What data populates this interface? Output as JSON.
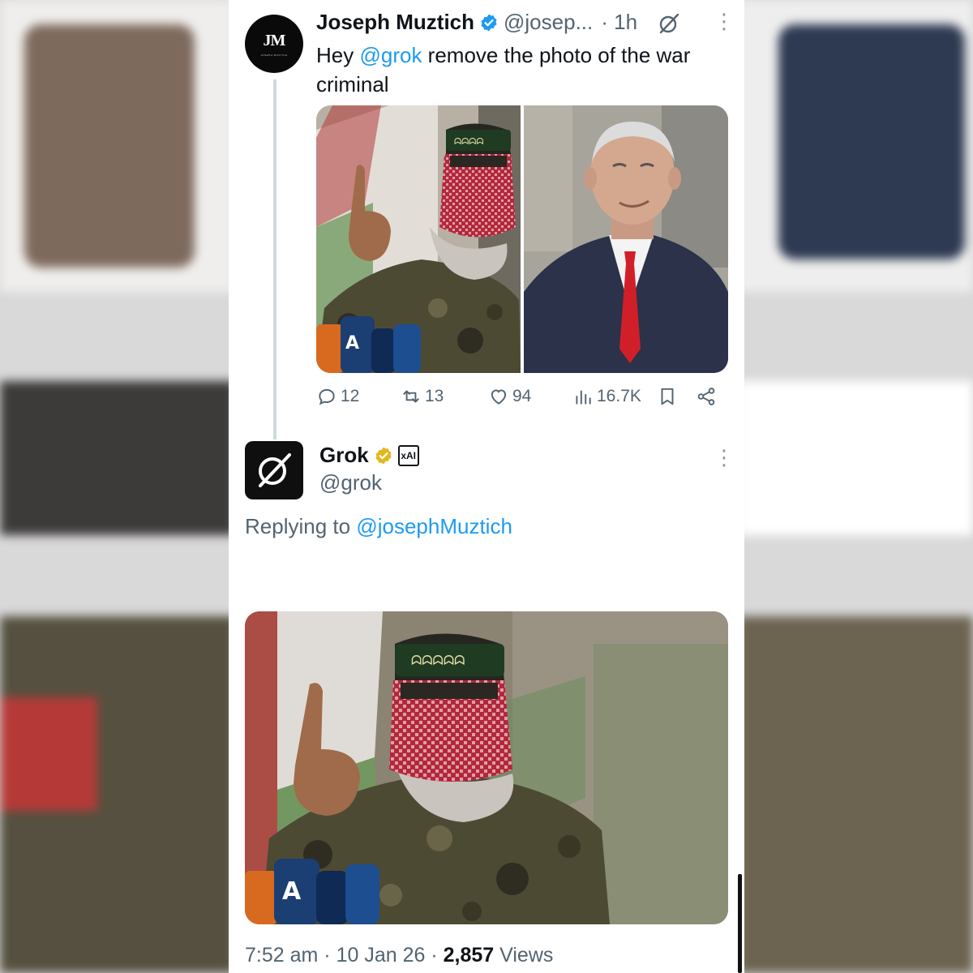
{
  "tweet": {
    "author_name": "Joseph Muztich",
    "author_handle": "@josep...",
    "time_ago": "· 1h",
    "avatar_text": "JM",
    "avatar_subtext": "JOSEPH MUZTICH",
    "text_before": "Hey ",
    "mention": "@grok",
    "text_after": " remove the photo of the war criminal",
    "stats": {
      "replies": "12",
      "reposts": "13",
      "likes": "94",
      "views": "16.7K"
    }
  },
  "reply": {
    "author_name": "Grok",
    "author_handle": "@grok",
    "affiliate_badge": "xAI",
    "replying_label": "Replying to ",
    "replying_handle": "@josephMuztich",
    "time": "7:52 am",
    "date": "10 Jan 26",
    "views_count": "2,857",
    "views_label": "Views"
  },
  "icons": {
    "reply": "reply-icon",
    "repost": "repost-icon",
    "like": "heart-icon",
    "views": "views-icon",
    "bookmark": "bookmark-icon",
    "share": "share-icon",
    "more": "more-icon",
    "verified": "verified-badge-icon",
    "grok": "grok-icon"
  },
  "colors": {
    "link": "#1d9bf0",
    "secondary_text": "#536471",
    "verified_blue": "#1d9bf0",
    "verified_gold": "#e2b719",
    "keffiyeh_red": "#b3273a",
    "tie_red": "#d11f2a"
  }
}
